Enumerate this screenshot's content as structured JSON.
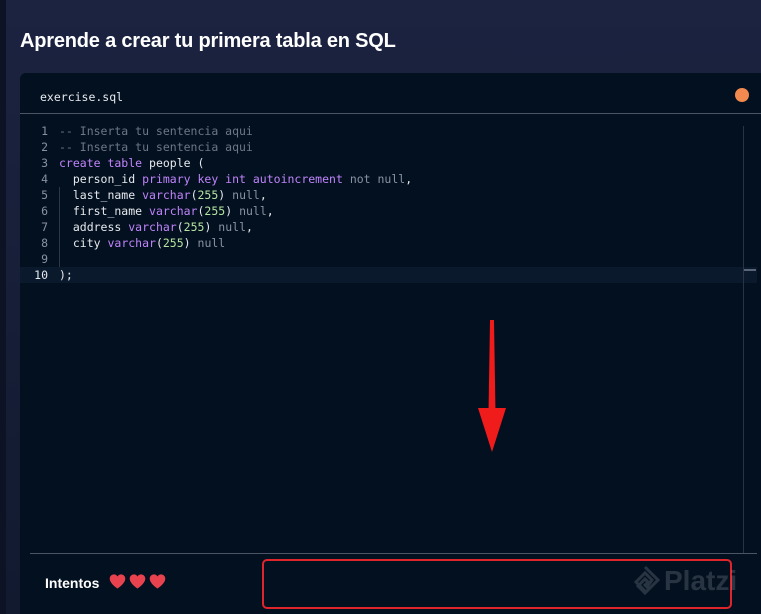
{
  "page": {
    "title": "Aprende a crear tu primera tabla en SQL"
  },
  "editor": {
    "tab": {
      "filename": "exercise.sql"
    },
    "status_color": "#f2894f",
    "lines": [
      {
        "number": "1",
        "tokens": [
          {
            "text": "-- Inserta tu sentencia aqui",
            "kind": "comment"
          }
        ]
      },
      {
        "number": "2",
        "tokens": [
          {
            "text": "-- Inserta tu sentencia aqui",
            "kind": "comment"
          }
        ]
      },
      {
        "number": "3",
        "tokens": [
          {
            "text": "create table",
            "kind": "keyword"
          },
          {
            "text": " people (",
            "kind": "plain"
          }
        ]
      },
      {
        "number": "4",
        "tokens": [
          {
            "text": "  person_id ",
            "kind": "plain"
          },
          {
            "text": "primary key int autoincrement",
            "kind": "keyword"
          },
          {
            "text": " not null",
            "kind": "null"
          },
          {
            "text": ",",
            "kind": "plain"
          }
        ]
      },
      {
        "number": "5",
        "tokens": [
          {
            "text": "  last_name ",
            "kind": "plain"
          },
          {
            "text": "varchar",
            "kind": "keyword"
          },
          {
            "text": "(",
            "kind": "plain"
          },
          {
            "text": "255",
            "kind": "num"
          },
          {
            "text": ") ",
            "kind": "plain"
          },
          {
            "text": "null",
            "kind": "null"
          },
          {
            "text": ",",
            "kind": "plain"
          }
        ]
      },
      {
        "number": "6",
        "tokens": [
          {
            "text": "  first_name ",
            "kind": "plain"
          },
          {
            "text": "varchar",
            "kind": "keyword"
          },
          {
            "text": "(",
            "kind": "plain"
          },
          {
            "text": "255",
            "kind": "num"
          },
          {
            "text": ") ",
            "kind": "plain"
          },
          {
            "text": "null",
            "kind": "null"
          },
          {
            "text": ",",
            "kind": "plain"
          }
        ]
      },
      {
        "number": "7",
        "tokens": [
          {
            "text": "  address ",
            "kind": "plain"
          },
          {
            "text": "varchar",
            "kind": "keyword"
          },
          {
            "text": "(",
            "kind": "plain"
          },
          {
            "text": "255",
            "kind": "num"
          },
          {
            "text": ") ",
            "kind": "plain"
          },
          {
            "text": "null",
            "kind": "null"
          },
          {
            "text": ",",
            "kind": "plain"
          }
        ]
      },
      {
        "number": "8",
        "tokens": [
          {
            "text": "  city ",
            "kind": "plain"
          },
          {
            "text": "varchar",
            "kind": "keyword"
          },
          {
            "text": "(",
            "kind": "plain"
          },
          {
            "text": "255",
            "kind": "num"
          },
          {
            "text": ") ",
            "kind": "plain"
          },
          {
            "text": "null",
            "kind": "null"
          }
        ]
      },
      {
        "number": "9",
        "tokens": []
      },
      {
        "number": "10",
        "tokens": [
          {
            "text": ");",
            "kind": "plain"
          }
        ],
        "active": true
      }
    ]
  },
  "footer": {
    "attempts_label": "Intentos",
    "attempts_remaining": 3,
    "heart_color": "#e8424f",
    "highlight_color": "#e0242b",
    "arrow_color": "#f01b1b"
  },
  "watermark": {
    "text": "Platzi",
    "icon": "platzi-logo-icon"
  }
}
